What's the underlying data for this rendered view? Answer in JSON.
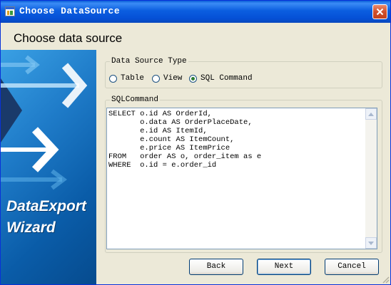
{
  "window": {
    "title": "Choose DataSource",
    "icons": {
      "app": "app-window-icon",
      "close": "close-icon"
    }
  },
  "header": {
    "title": "Choose data source"
  },
  "banner": {
    "line1": "DataExport",
    "line2": "Wizard",
    "icons": [
      "arrow-right-icon"
    ]
  },
  "datasource_type": {
    "legend": "Data Source Type",
    "options": [
      {
        "label": "Table",
        "selected": false
      },
      {
        "label": "View",
        "selected": false
      },
      {
        "label": "SQL Command",
        "selected": true
      }
    ]
  },
  "sql_command": {
    "legend": "SQLCommand",
    "lines": [
      "SELECT o.id AS OrderId,",
      "       o.data AS OrderPlaceDate,",
      "       e.id AS ItemId,",
      "       e.count AS ItemCount,",
      "       e.price AS ItemPrice",
      "FROM   order AS o, order_item as e",
      "WHERE  o.id = e.order_id"
    ],
    "scrollbar_icons": [
      "scroll-up-icon",
      "scroll-down-icon"
    ]
  },
  "buttons": {
    "back": "Back",
    "next": "Next",
    "cancel": "Cancel"
  },
  "colors": {
    "titlebar": "#0a5fd8",
    "banner": "#1f7cc9",
    "dialog_bg": "#ece9d8",
    "close_button": "#d2502b"
  }
}
